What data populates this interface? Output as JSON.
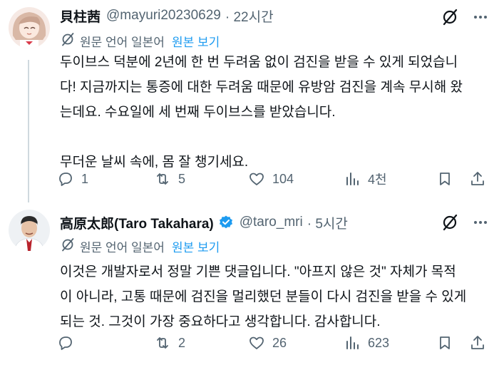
{
  "tweets": [
    {
      "name": "貝柱茜",
      "handle": "@mayuri20230629",
      "time": "· 22시간",
      "translate_label": "원문 언어 일본어",
      "show_original": "원본 보기",
      "paragraphs": [
        "두이브스 덕분에 2년에 한 번 두려움 없이 검진을 받을 수 있게 되었습니",
        "다! 지금까지는 통증에 대한 두려움 때문에 유방암 검진을 계속 무시해 왔",
        "는데요. 수요일에 세 번째 두이브스를 받았습니다.",
        "",
        "무더운 날씨 속에, 몸 잘 챙기세요."
      ],
      "replies": "1",
      "reposts": "5",
      "likes": "104",
      "views": "4천"
    },
    {
      "name": "高原太郎(Taro Takahara)",
      "handle": "@taro_mri",
      "time": "· 5시간",
      "translate_label": "원문 언어 일본어",
      "show_original": "원본 보기",
      "paragraphs": [
        "이것은 개발자로서 정말 기쁜 댓글입니다. \"아프지 않은 것\" 자체가 목적",
        "이 아니라, 고통 때문에 검진을 멀리했던 분들이 다시 검진을 받을 수 있게",
        "되는 것. 그것이 가장 중요하다고 생각합니다. 감사합니다."
      ],
      "replies": "",
      "reposts": "2",
      "likes": "26",
      "views": "623"
    }
  ],
  "colors": {
    "text": "#0f1419",
    "secondary": "#536471",
    "link": "#1d9bf0",
    "verified": "#1d9bf0",
    "line": "#cfd9de"
  }
}
